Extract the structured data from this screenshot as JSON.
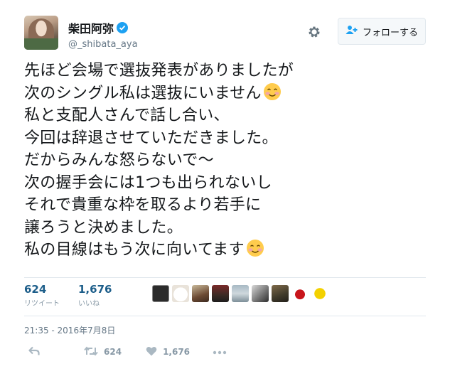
{
  "header": {
    "display_name": "柴田阿弥",
    "handle": "@_shibata_aya",
    "follow_label": "フォローする"
  },
  "tweet": {
    "lines": [
      "先ほど会場で選抜発表がありましたが",
      "次のシングル私は選抜にいません",
      "私と支配人さんで話し合い、",
      "今回は辞退させていただきました。",
      "だからみんな怒らないで～",
      "次の握手会には1つも出られないし",
      "それで貴重な枠を取るより若手に",
      "譲ろうと決めました。",
      "私の目線はもう次に向いてます"
    ],
    "emoji_name": "smiling-face-with-blush"
  },
  "stats": {
    "retweets": {
      "count": "624",
      "label": "リツイート"
    },
    "likes": {
      "count": "1,676",
      "label": "いいね"
    }
  },
  "timestamp": "21:35 - 2016年7月8日",
  "actions": {
    "retweet_count": "624",
    "like_count": "1,676"
  },
  "colors": {
    "accent": "#1da1f2",
    "stat_number": "#1d5e8a",
    "muted": "#8899a6"
  }
}
